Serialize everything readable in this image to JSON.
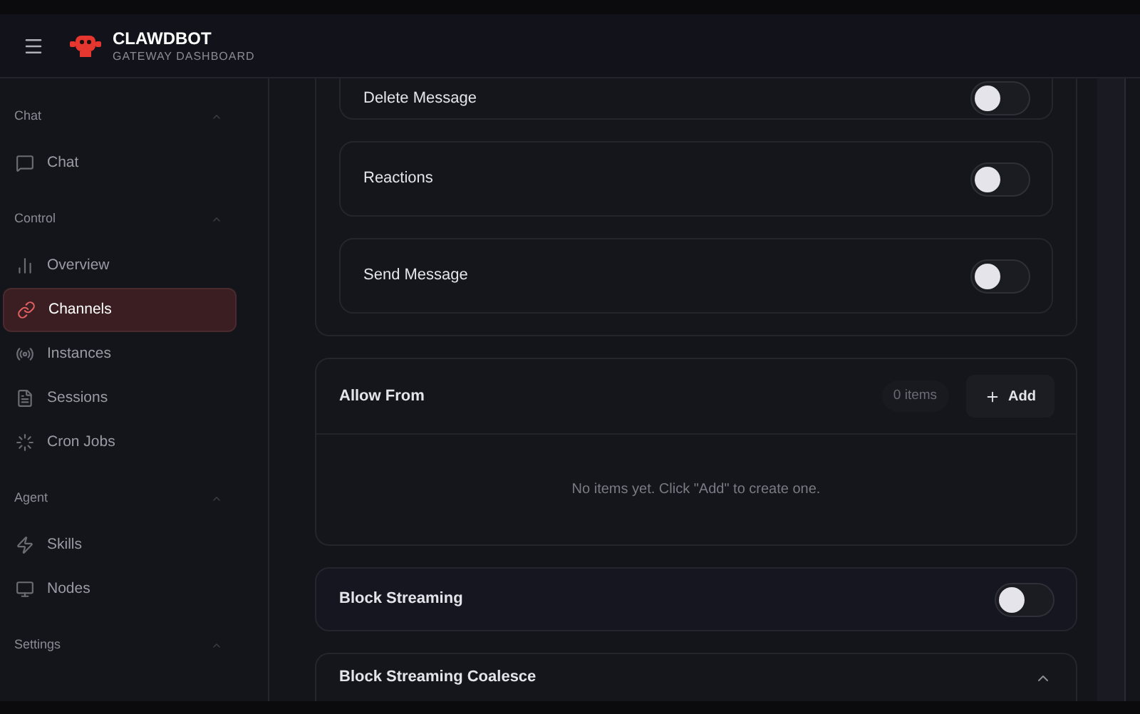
{
  "header": {
    "title": "CLAWDBOT",
    "subtitle": "GATEWAY DASHBOARD"
  },
  "sidebar": {
    "groups": [
      {
        "label": "Chat",
        "expanded": true,
        "items": [
          {
            "label": "Chat",
            "kind": "chat",
            "selected": false
          }
        ]
      },
      {
        "label": "Control",
        "expanded": true,
        "items": [
          {
            "label": "Overview",
            "kind": "bars",
            "selected": false
          },
          {
            "label": "Channels",
            "kind": "link",
            "selected": true
          },
          {
            "label": "Instances",
            "kind": "radio",
            "selected": false
          },
          {
            "label": "Sessions",
            "kind": "file",
            "selected": false
          },
          {
            "label": "Cron Jobs",
            "kind": "loader",
            "selected": false
          }
        ]
      },
      {
        "label": "Agent",
        "expanded": true,
        "items": [
          {
            "label": "Skills",
            "kind": "zap",
            "selected": false
          },
          {
            "label": "Nodes",
            "kind": "monitor",
            "selected": false
          }
        ]
      },
      {
        "label": "Settings",
        "expanded": true
      }
    ]
  },
  "actions": [
    {
      "label": "Delete Message",
      "on": false
    },
    {
      "label": "Reactions",
      "on": false
    },
    {
      "label": "Send Message",
      "on": false
    }
  ],
  "allow_from": {
    "title": "Allow From",
    "count": "0 items",
    "add_button": "Add",
    "empty_text": "No items yet. Click \"Add\" to create one."
  },
  "block_streaming": {
    "label": "Block Streaming",
    "on": false
  },
  "block_streaming_coalesce": {
    "label": "Block Streaming Coalesce",
    "expanded": true
  }
}
